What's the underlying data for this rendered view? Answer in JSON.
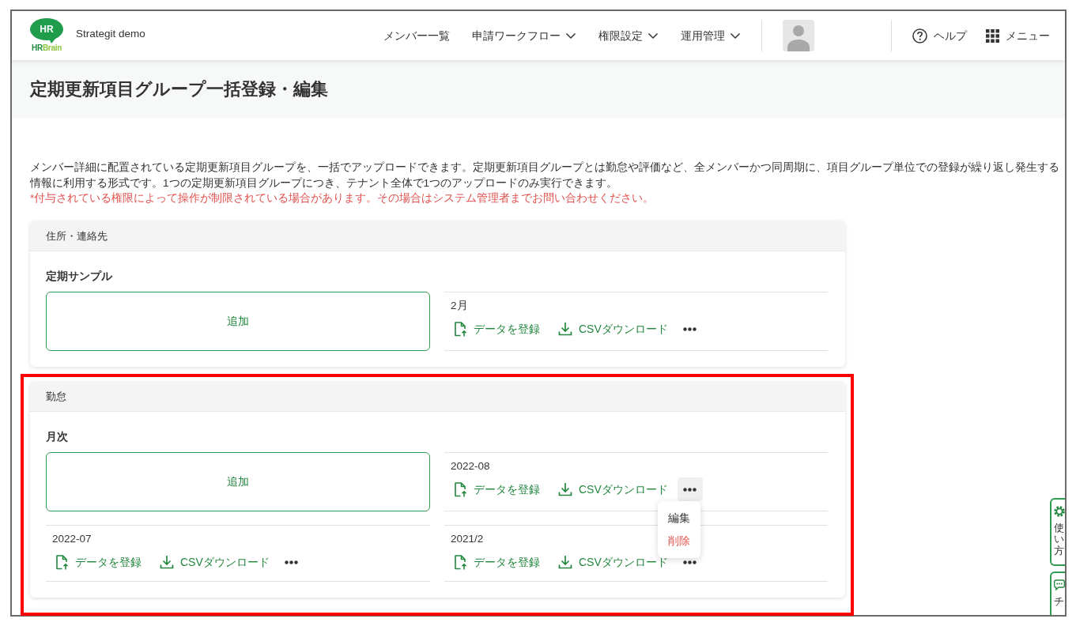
{
  "header": {
    "logo": {
      "badge": "HR",
      "caption": [
        "HR",
        "Brain"
      ]
    },
    "tenant": "Strategit demo",
    "nav": [
      {
        "label": "メンバー一覧",
        "has_dropdown": false
      },
      {
        "label": "申請ワークフロー",
        "has_dropdown": true
      },
      {
        "label": "権限設定",
        "has_dropdown": true
      },
      {
        "label": "運用管理",
        "has_dropdown": true
      }
    ],
    "help": {
      "label": "ヘルプ"
    },
    "menu": {
      "label": "メニュー"
    }
  },
  "page_title": "定期更新項目グループ一括登録・編集",
  "description": "メンバー詳細に配置されている定期更新項目グループを、一括でアップロードできます。定期更新項目グループとは勤怠や評価など、全メンバーかつ同周期に、項目グループ単位での登録が繰り返し発生する情報に利用する形式です。1つの定期更新項目グループにつき、テナント全体で1つのアップロードのみ実行できます。",
  "notice": "*付与されている権限によって操作が制限されている場合があります。その場合はシステム管理者までお問い合わせください。",
  "sections": [
    {
      "title": "住所・連絡先",
      "highlighted": false,
      "groups": [
        {
          "name": "定期サンプル",
          "add_label": "追加",
          "entries": [
            {
              "period": "2月",
              "register_label": "データを登録",
              "download_label": "CSVダウンロード",
              "menu_open": false
            }
          ]
        }
      ]
    },
    {
      "title": "勤怠",
      "highlighted": true,
      "groups": [
        {
          "name": "月次",
          "add_label": "追加",
          "entries": [
            {
              "period": "2022-08",
              "register_label": "データを登録",
              "download_label": "CSVダウンロード",
              "menu_open": true,
              "menu_items": [
                {
                  "label": "編集",
                  "kind": "edit"
                },
                {
                  "label": "削除",
                  "kind": "delete"
                }
              ]
            },
            {
              "period": "2022-07",
              "register_label": "データを登録",
              "download_label": "CSVダウンロード",
              "menu_open": false
            },
            {
              "period": "2021/2",
              "register_label": "データを登録",
              "download_label": "CSVダウンロード",
              "menu_open": false
            }
          ]
        }
      ]
    }
  ],
  "side_tabs": [
    {
      "kind": "guide",
      "label": "使い方"
    },
    {
      "kind": "chat",
      "label": "チ"
    }
  ]
}
